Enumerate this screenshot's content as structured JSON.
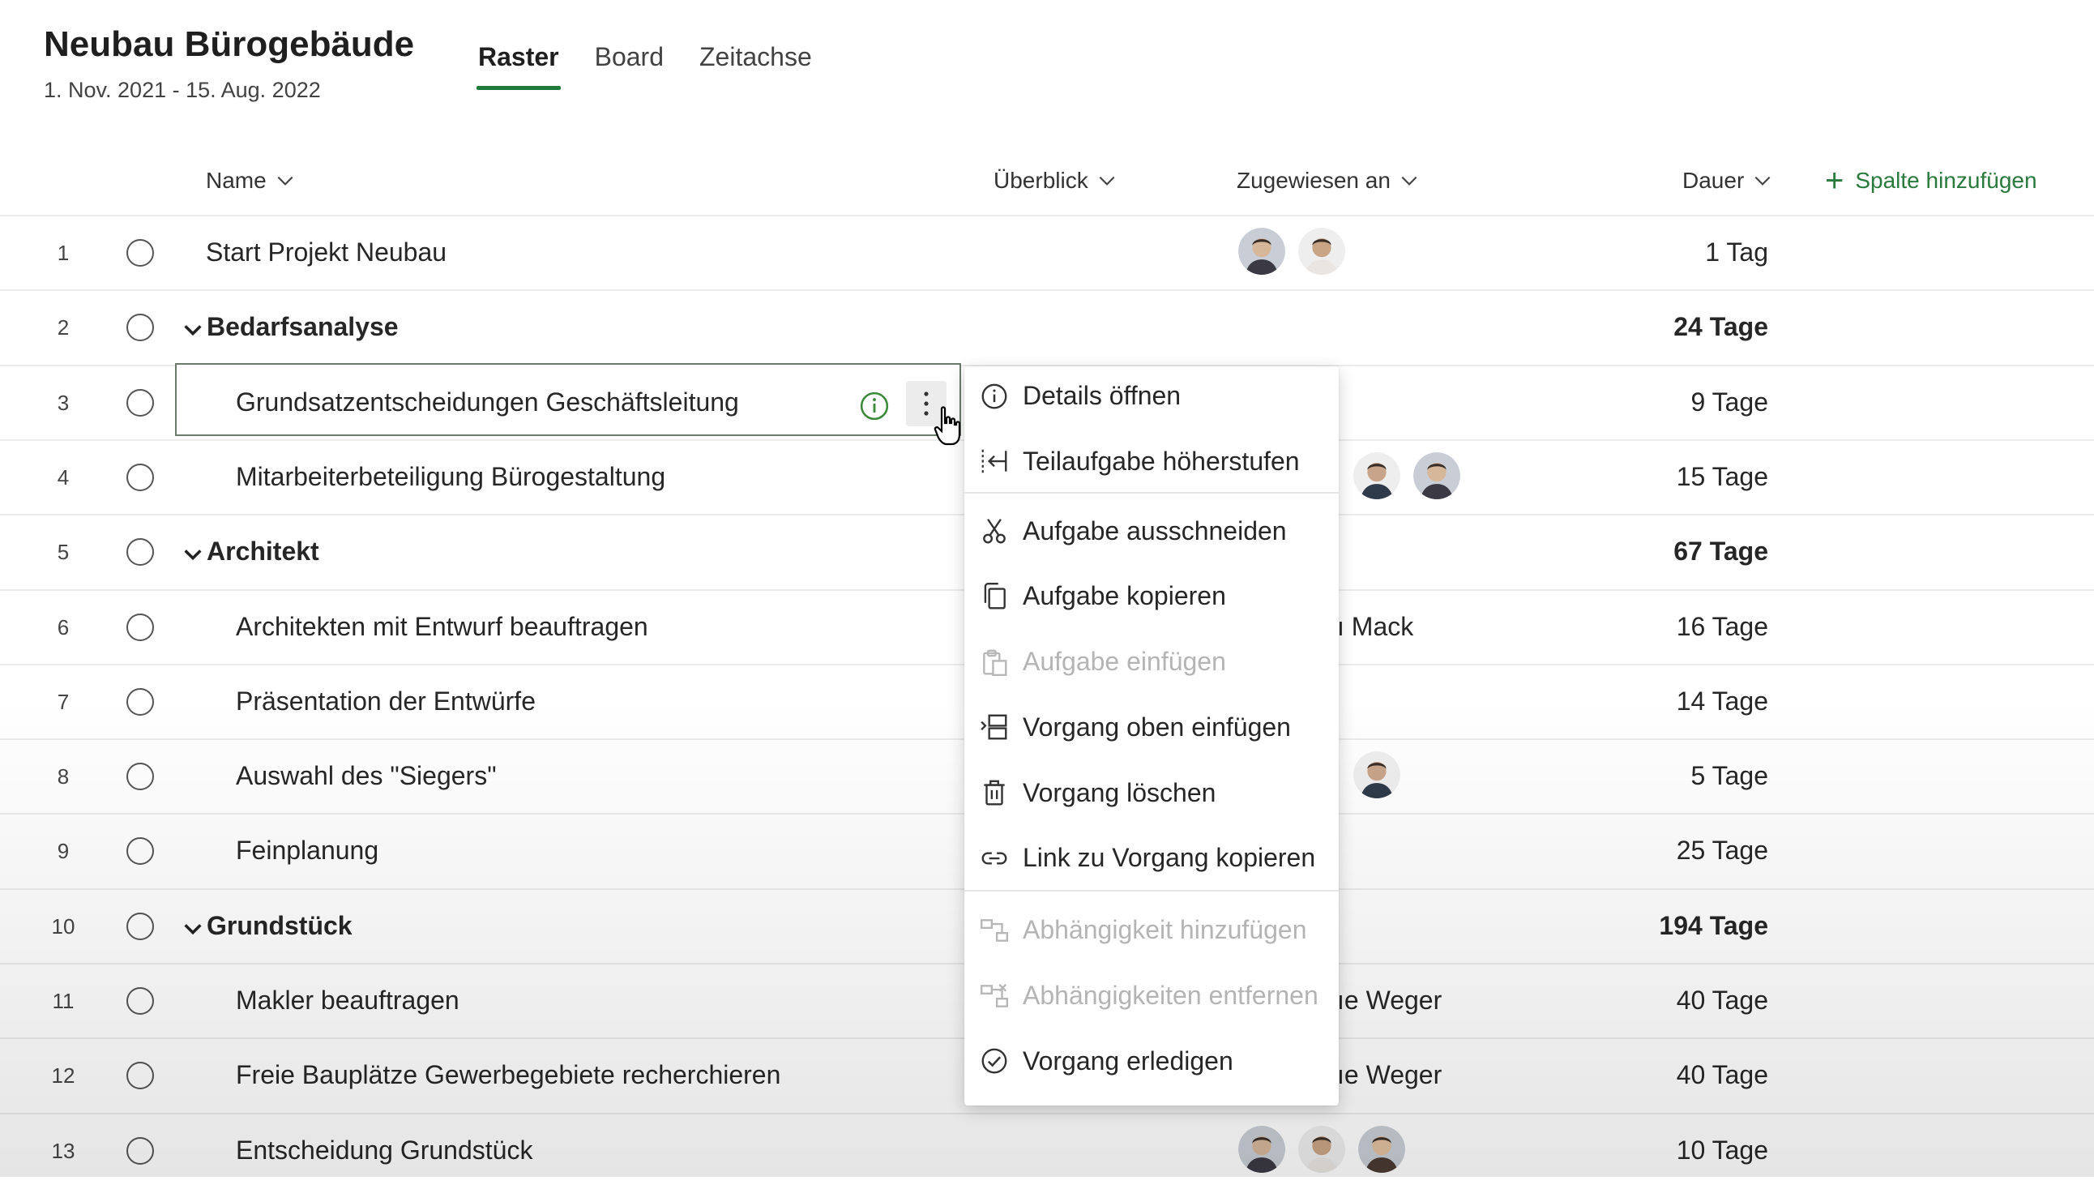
{
  "header": {
    "title": "Neubau Bürogebäude",
    "date_range": "1. Nov. 2021 - 15. Aug. 2022",
    "tabs": [
      {
        "label": "Raster",
        "active": true
      },
      {
        "label": "Board",
        "active": false
      },
      {
        "label": "Zeitachse",
        "active": false
      }
    ]
  },
  "columns": {
    "name": "Name",
    "overview": "Überblick",
    "assigned": "Zugewiesen an",
    "duration": "Dauer",
    "add_column": "Spalte hinzufügen"
  },
  "rows": [
    {
      "num": "1",
      "name": "Start Projekt Neubau",
      "duration": "1 Tag",
      "type": "top",
      "avatars": 2,
      "assigned_text": ""
    },
    {
      "num": "2",
      "name": "Bedarfsanalyse",
      "duration": "24 Tage",
      "type": "group",
      "avatars": 0,
      "assigned_text": ""
    },
    {
      "num": "3",
      "name": "Grundsatzentscheidungen Geschäftsleitung",
      "duration": "9 Tage",
      "type": "sub",
      "avatars": 0,
      "assigned_text": "",
      "selected": true
    },
    {
      "num": "4",
      "name": "Mitarbeiterbeteiligung Bürogestaltung",
      "duration": "15 Tage",
      "type": "sub",
      "avatars": 2,
      "assigned_text": ""
    },
    {
      "num": "5",
      "name": "Architekt",
      "duration": "67 Tage",
      "type": "group",
      "avatars": 0,
      "assigned_text": ""
    },
    {
      "num": "6",
      "name": "Architekten mit Entwurf beauftragen",
      "duration": "16 Tage",
      "type": "sub",
      "avatars": 0,
      "assigned_text": "ı Mack"
    },
    {
      "num": "7",
      "name": "Präsentation der Entwürfe",
      "duration": "14 Tage",
      "type": "sub",
      "avatars": 0,
      "assigned_text": ""
    },
    {
      "num": "8",
      "name": "Auswahl des \"Siegers\"",
      "duration": "5 Tage",
      "type": "sub",
      "avatars": 1,
      "assigned_text": ""
    },
    {
      "num": "9",
      "name": "Feinplanung",
      "duration": "25 Tage",
      "type": "sub",
      "avatars": 0,
      "assigned_text": ""
    },
    {
      "num": "10",
      "name": "Grundstück",
      "duration": "194 Tage",
      "type": "group",
      "avatars": 0,
      "assigned_text": ""
    },
    {
      "num": "11",
      "name": "Makler beauftragen",
      "duration": "40 Tage",
      "type": "sub",
      "avatars": 0,
      "assigned_text": "ıe Weger"
    },
    {
      "num": "12",
      "name": "Freie Bauplätze Gewerbegebiete recherchieren",
      "duration": "40 Tage",
      "type": "sub",
      "avatars": 0,
      "assigned_text": "ıe Weger"
    },
    {
      "num": "13",
      "name": "Entscheidung Grundstück",
      "duration": "10 Tage",
      "type": "sub",
      "avatars": 3,
      "assigned_text": ""
    }
  ],
  "context_menu": {
    "items": [
      {
        "label": "Details öffnen",
        "icon": "info-icon",
        "disabled": false
      },
      {
        "label": "Teilaufgabe höherstufen",
        "icon": "promote-icon",
        "disabled": false
      },
      {
        "label": "Aufgabe ausschneiden",
        "icon": "scissors-icon",
        "disabled": false
      },
      {
        "label": "Aufgabe kopieren",
        "icon": "copy-icon",
        "disabled": false
      },
      {
        "label": "Aufgabe einfügen",
        "icon": "paste-icon",
        "disabled": true
      },
      {
        "label": "Vorgang oben einfügen",
        "icon": "insert-above-icon",
        "disabled": false
      },
      {
        "label": "Vorgang löschen",
        "icon": "trash-icon",
        "disabled": false
      },
      {
        "label": "Link zu Vorgang kopieren",
        "icon": "link-icon",
        "disabled": false
      },
      {
        "label": "Abhängigkeit hinzufügen",
        "icon": "add-dependency-icon",
        "disabled": true
      },
      {
        "label": "Abhängigkeiten entfernen",
        "icon": "remove-dependency-icon",
        "disabled": true
      },
      {
        "label": "Vorgang erledigen",
        "icon": "check-circle-icon",
        "disabled": false
      }
    ]
  },
  "colors": {
    "accent": "#1f7a3a",
    "info_green": "#3a8a3a"
  }
}
